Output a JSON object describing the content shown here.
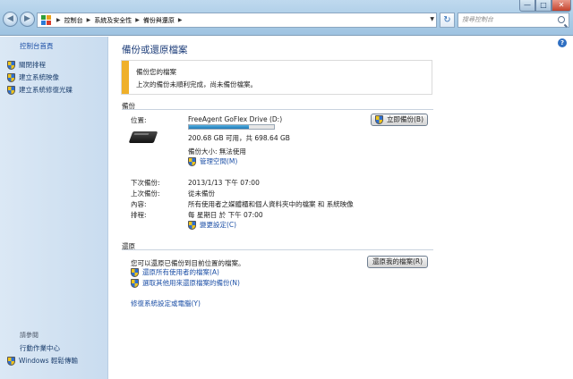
{
  "toolbar": {
    "breadcrumbs": [
      "控制台",
      "系統及安全性",
      "備份與還原"
    ],
    "search_placeholder": "搜尋控制台"
  },
  "sidebar": {
    "home": "控制台首頁",
    "items": [
      "關閉排程",
      "建立系統映像",
      "建立系統修復光碟"
    ],
    "see_also": "請參閱",
    "action_center": "行動作業中心",
    "transfer": "Windows 輕鬆傳輸"
  },
  "main": {
    "title": "備份或還原檔案",
    "warning": {
      "title": "備份您的檔案",
      "message": "上次的備份未順利完成，尚未備份檔案。"
    },
    "backup": {
      "section": "備份",
      "location_label": "位置:",
      "drive_name": "FreeAgent GoFlex Drive (D:)",
      "used_fraction": 0.71,
      "space": "200.68 GB 可用，共 698.64 GB",
      "backup_size": "備份大小: 無法使用",
      "manage_space": "管理空間(M)",
      "backup_now": "立即備份(B)",
      "next_label": "下次備份:",
      "next_value": "2013/1/13 下午 07:00",
      "last_label": "上次備份:",
      "last_value": "從未備份",
      "content_label": "內容:",
      "content_value": "所有使用者之媒體櫃和個人資料夾中的檔案 和 系統映像",
      "schedule_label": "排程:",
      "schedule_value": "每 星期日 於 下午 07:00",
      "change_settings": "變更設定(C)"
    },
    "restore": {
      "section": "還原",
      "description": "您可以還原已備份到目前位置的檔案。",
      "restore_mine": "還原我的檔案(R)",
      "restore_all_users": "還原所有使用者的檔案(A)",
      "select_other": "選取其他用來還原檔案的備份(N)",
      "recover_system": "修復系統設定或電腦(Y)"
    }
  }
}
